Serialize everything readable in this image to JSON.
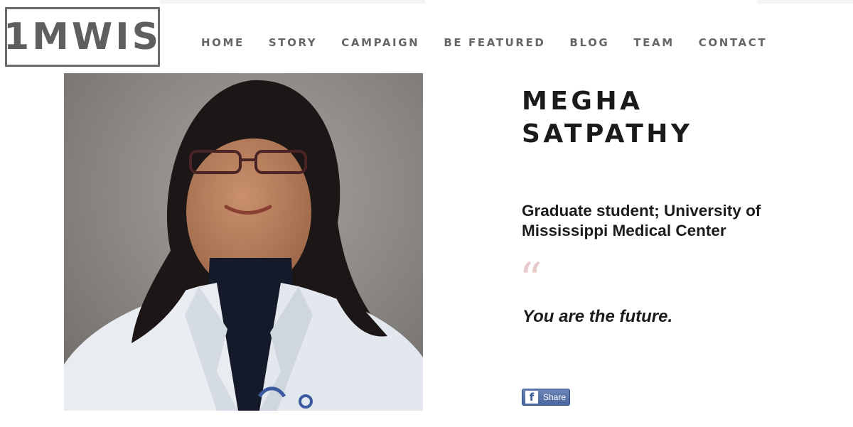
{
  "site": {
    "logo": "1MWIS"
  },
  "nav": {
    "items": [
      {
        "label": "HOME"
      },
      {
        "label": "STORY"
      },
      {
        "label": "CAMPAIGN"
      },
      {
        "label": "BE FEATURED"
      },
      {
        "label": "BLOG"
      },
      {
        "label": "TEAM"
      },
      {
        "label": "CONTACT"
      }
    ]
  },
  "profile": {
    "name_line1": "MEGHA",
    "name_line2": "SATPATHY",
    "title_line1": "Graduate student; University of",
    "title_line2": "Mississippi Medical Center",
    "quote_mark": "“",
    "quote": "You are the future."
  },
  "share": {
    "icon": "facebook-icon",
    "label": "Share"
  },
  "colors": {
    "logo": "#5f5f5f",
    "nav": "#666666",
    "text": "#1d1d1d",
    "quote_mark": "#e8c9cc",
    "facebook": "#4a67a1"
  }
}
